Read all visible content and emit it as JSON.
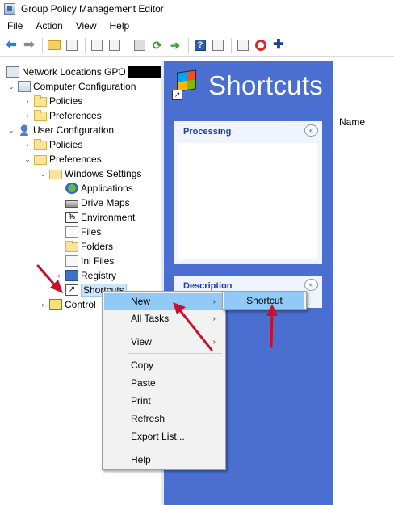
{
  "window": {
    "title": "Group Policy Management Editor",
    "app_icon": "gpo-editor-icon"
  },
  "menubar": {
    "items": [
      "File",
      "Action",
      "View",
      "Help"
    ]
  },
  "toolbar": {
    "buttons": [
      "back-arrow-icon",
      "forward-arrow-icon",
      "up-folder-icon",
      "show-hide-tree-icon",
      "copy-icon",
      "paste-icon",
      "print-icon",
      "refresh-icon",
      "export-list-icon",
      "help-icon",
      "show-hide-action-pane-icon",
      "properties-icon",
      "stop-icon",
      "add-icon"
    ]
  },
  "tree": {
    "root": "Network Locations GPO",
    "computer_configuration": "Computer Configuration",
    "cc_policies": "Policies",
    "cc_preferences": "Preferences",
    "user_configuration": "User Configuration",
    "uc_policies": "Policies",
    "uc_preferences": "Preferences",
    "windows_settings": "Windows Settings",
    "applications": "Applications",
    "drive_maps": "Drive Maps",
    "environment": "Environment",
    "files": "Files",
    "folders": "Folders",
    "ini_files": "Ini Files",
    "registry": "Registry",
    "shortcuts": "Shortcuts",
    "control_panel": "Control"
  },
  "taskpad": {
    "title": "Shortcuts",
    "processing": "Processing",
    "description": "Description",
    "collapse_glyph": "«"
  },
  "details": {
    "column_name": "Name"
  },
  "context_menu": {
    "new": "New",
    "all_tasks": "All Tasks",
    "view": "View",
    "copy": "Copy",
    "paste": "Paste",
    "print": "Print",
    "refresh": "Refresh",
    "export_list": "Export List...",
    "help": "Help",
    "submenu_arrow": "›"
  },
  "submenu": {
    "shortcut": "Shortcut"
  },
  "colors": {
    "taskpad_blue": "#4a6fd1",
    "highlight": "#91c9f7",
    "annotation_red": "#c8102e",
    "redaction": "#000000"
  }
}
